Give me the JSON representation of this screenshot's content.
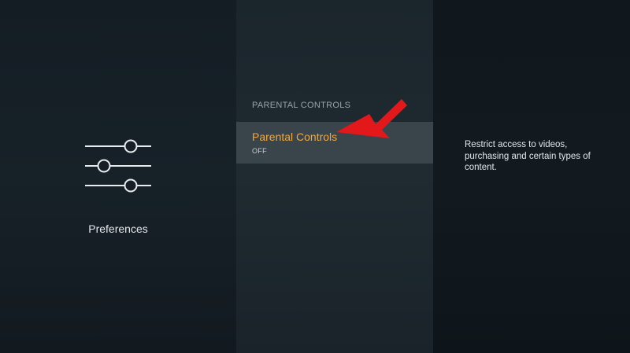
{
  "category": {
    "icon": "sliders-icon",
    "label": "Preferences"
  },
  "menu": {
    "section_header": "PARENTAL CONTROLS",
    "items": [
      {
        "label": "Parental Controls",
        "value": "OFF",
        "selected": true
      }
    ]
  },
  "description": "Restrict access to videos, purchasing and certain types of content.",
  "annotation": {
    "icon": "arrow-icon",
    "color": "#e3181b"
  },
  "colors": {
    "accent": "#f3a83b",
    "selected_row": "#3a444b"
  }
}
